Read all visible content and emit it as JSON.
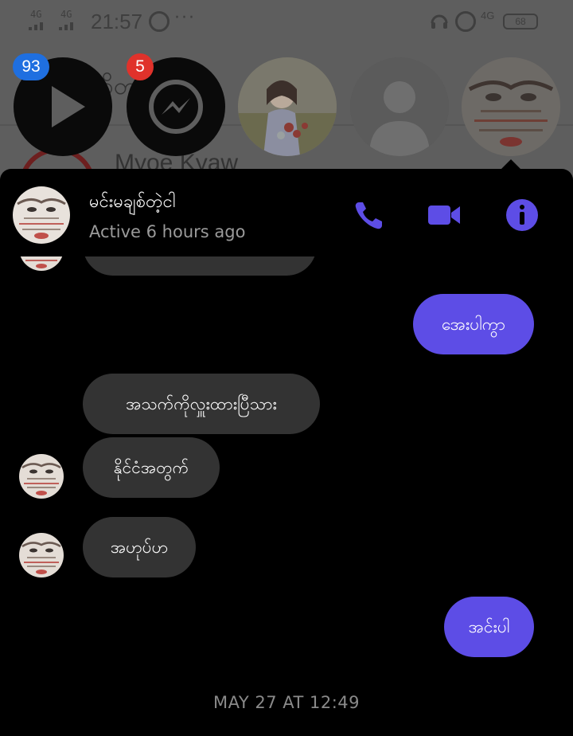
{
  "status_bar": {
    "signal_1": "4G",
    "signal_2": "4G",
    "time": "21:57",
    "dots": "···",
    "network": "4G",
    "battery": "68"
  },
  "background": {
    "fragment_top": "ဝိတ",
    "fragment_name": "Myoe Kyaw"
  },
  "chat_heads": {
    "play_badge": "93",
    "messenger_badge": "5"
  },
  "chat": {
    "contact_name": "မင်းမချစ်တဲ့ငါ",
    "status": "Active 6 hours ago",
    "timestamp": "MAY 27 AT 12:49",
    "messages": [
      {
        "dir": "out",
        "text": "အေးပါကွာ"
      },
      {
        "dir": "in",
        "text": "အသက်ကိုလှူးထားပြီသား"
      },
      {
        "dir": "in",
        "text": "နိုင်ငံအတွက်"
      },
      {
        "dir": "in",
        "text": "အဟုပ်ဟ"
      },
      {
        "dir": "out",
        "text": "အင်းပါ"
      }
    ]
  },
  "colors": {
    "accent": "#5d4de6",
    "incoming_bubble": "#333333",
    "badge_blue": "#1f6fe0",
    "badge_red": "#e0322b",
    "icon_blue": "#5d4de6"
  }
}
